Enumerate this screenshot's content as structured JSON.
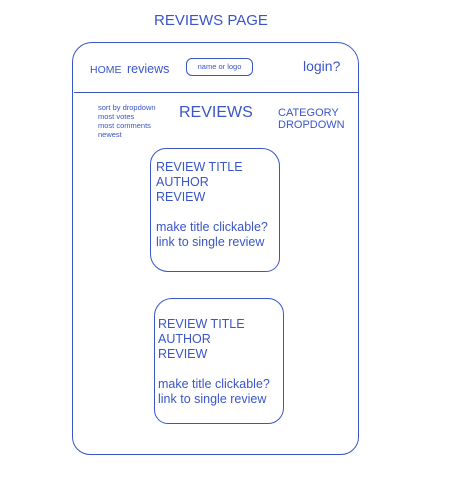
{
  "page_title": "REVIEWS PAGE",
  "header": {
    "home": "HOME",
    "reviews": "reviews",
    "logo": "name or logo",
    "login": "login?"
  },
  "sort_dropdown": {
    "label": "sort by dropdown",
    "options": [
      "most votes",
      "most comments",
      "newest"
    ]
  },
  "section_heading": "REVIEWS",
  "category_dropdown": "CATEGORY\nDROPDOWN",
  "review_cards": [
    {
      "title": "REVIEW TITLE",
      "author": "AUTHOR",
      "review": "REVIEW",
      "note_line1": "make title clickable?",
      "note_line2": "link to single review"
    },
    {
      "title": "REVIEW TITLE",
      "author": "AUTHOR",
      "review": "REVIEW",
      "note_line1": "make title clickable?",
      "note_line2": "link to single review"
    }
  ],
  "colors": {
    "ink": "#3a55c8",
    "background": "#ffffff"
  }
}
